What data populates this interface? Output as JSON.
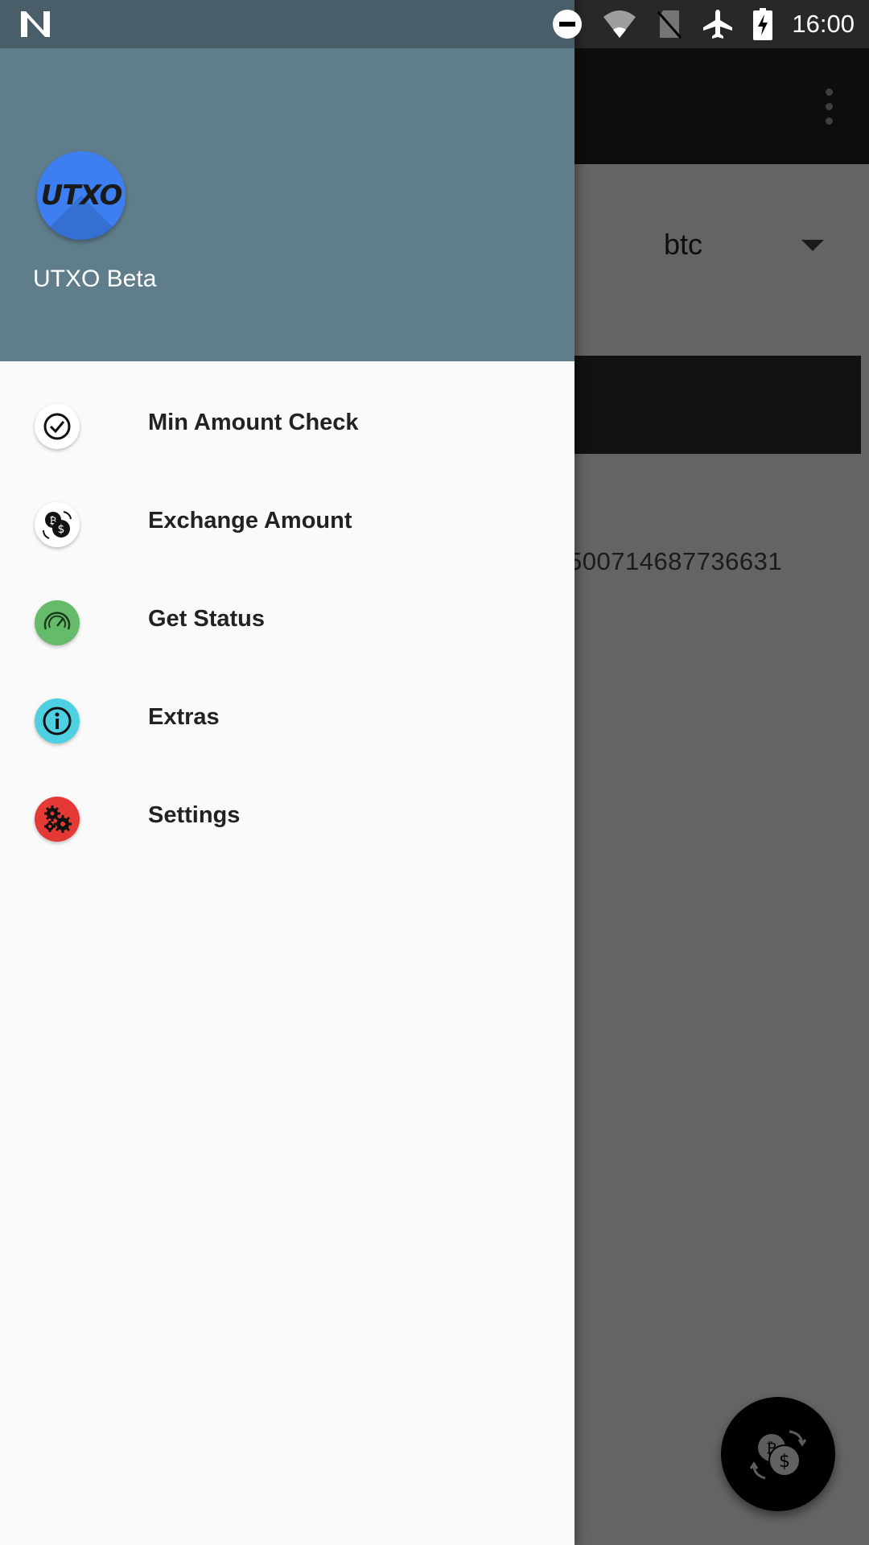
{
  "status_bar": {
    "time": "16:00",
    "icons": [
      "n-logo-icon",
      "do-not-disturb-icon",
      "wifi-icon",
      "no-sim-icon",
      "airplane-mode-icon",
      "battery-charging-icon"
    ]
  },
  "background_app": {
    "currency_value": "btc",
    "amount_text": "500714687736631",
    "overflow_icon": "more-vert-icon",
    "fab_icon": "exchange-icon"
  },
  "drawer": {
    "header": {
      "avatar_text": "UTXO",
      "app_name": "UTXO Beta",
      "color": "#607d8b"
    },
    "items": [
      {
        "label": "Min Amount Check",
        "icon": "check-circle-icon",
        "color": "#ffffff"
      },
      {
        "label": "Exchange Amount",
        "icon": "exchange-icon",
        "color": "#ffffff"
      },
      {
        "label": "Get Status",
        "icon": "speedometer-icon",
        "color": "#66bb6a"
      },
      {
        "label": "Extras",
        "icon": "info-icon",
        "color": "#4dd0e1"
      },
      {
        "label": "Settings",
        "icon": "gears-icon",
        "color": "#e53935"
      }
    ]
  }
}
